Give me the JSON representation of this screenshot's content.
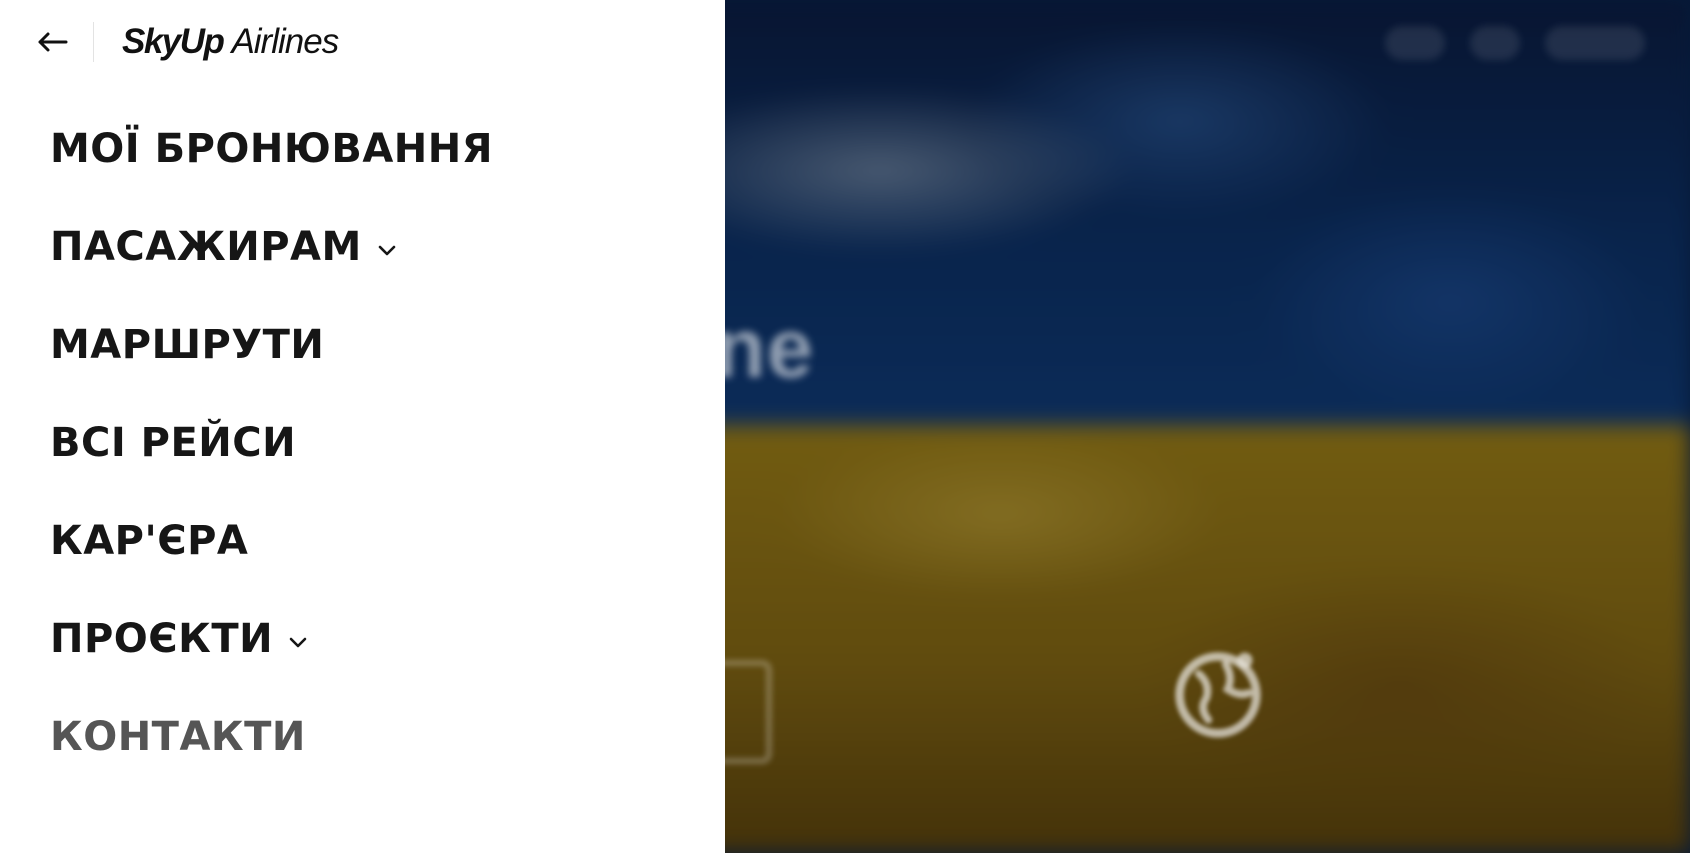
{
  "header": {
    "back_icon": "arrow-left-icon",
    "logo": {
      "brand_bold": "SkyUp",
      "brand_light": "Airlines"
    }
  },
  "menu": {
    "items": [
      {
        "label": "МОЇ БРОНЮВАННЯ",
        "has_dropdown": false
      },
      {
        "label": "ПАСАЖИРАМ",
        "has_dropdown": true
      },
      {
        "label": "МАРШРУТИ",
        "has_dropdown": false
      },
      {
        "label": "ВСІ РЕЙСИ",
        "has_dropdown": false
      },
      {
        "label": "КАР'ЄРА",
        "has_dropdown": false
      },
      {
        "label": "ПРОЄКТИ",
        "has_dropdown": true
      },
      {
        "label": "КОНТАКТИ",
        "has_dropdown": false,
        "muted": true
      }
    ]
  },
  "background": {
    "description_icons": [
      "globe-icon"
    ],
    "colors": {
      "flag_blue": "#0f3a7a",
      "flag_yellow": "#b8951c",
      "menu_text": "#161616",
      "muted_text": "#555555"
    }
  }
}
